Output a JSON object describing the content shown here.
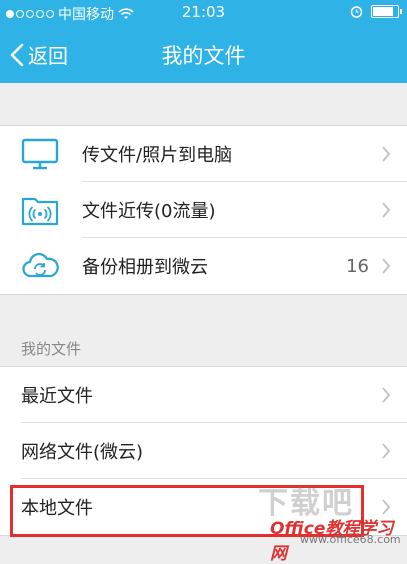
{
  "status_bar": {
    "carrier": "中国移动",
    "time": "21:03"
  },
  "nav": {
    "back_label": "返回",
    "title": "我的文件"
  },
  "main_group": {
    "items": [
      {
        "label": "传文件/照片到电脑",
        "icon": "computer-icon",
        "count": ""
      },
      {
        "label": "文件近传(0流量)",
        "icon": "wireless-folder-icon",
        "count": ""
      },
      {
        "label": "备份相册到微云",
        "icon": "cloud-sync-icon",
        "count": "16"
      }
    ]
  },
  "section_title": "我的文件",
  "files_group": {
    "items": [
      {
        "label": "最近文件"
      },
      {
        "label": "网络文件(微云)"
      },
      {
        "label": "本地文件"
      }
    ]
  },
  "watermark": {
    "logo_text": "下载吧",
    "brand": "Office教程学习网",
    "url": "www.office68.com"
  },
  "colors": {
    "header": "#2fb3e6",
    "icon": "#2aa5d8",
    "highlight": "#e3302f"
  }
}
